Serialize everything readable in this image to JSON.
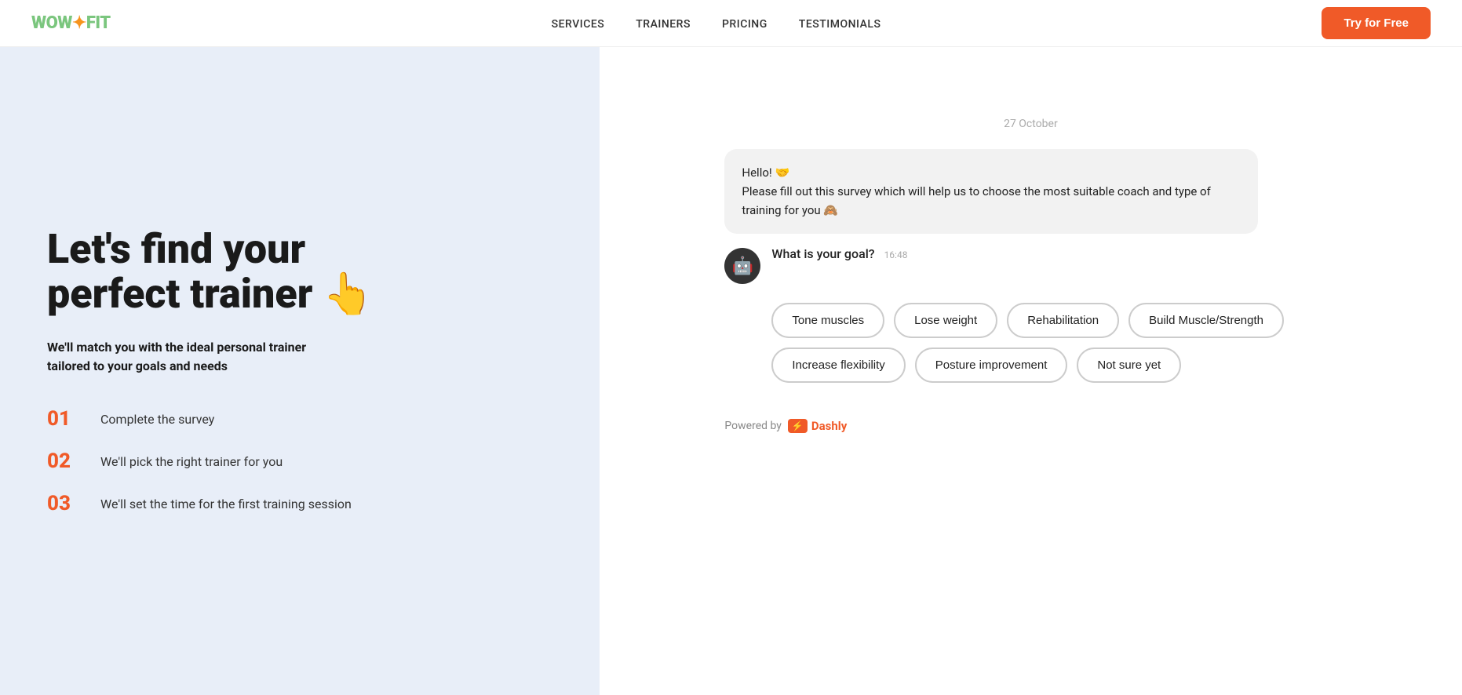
{
  "nav": {
    "logo": "WOW",
    "logo_fit": "FIT",
    "links": [
      {
        "label": "SERVICES",
        "href": "#"
      },
      {
        "label": "TRAINERS",
        "href": "#"
      },
      {
        "label": "PRICING",
        "href": "#"
      },
      {
        "label": "TESTIMONIALS",
        "href": "#"
      }
    ],
    "cta": "Try for Free"
  },
  "left": {
    "hero_title_line1": "Let's find your",
    "hero_title_line2": "perfect trainer 👆",
    "hero_subtitle": "We'll match you with the ideal personal trainer tailored to your goals and needs",
    "steps": [
      {
        "num": "01",
        "text": "Complete the survey"
      },
      {
        "num": "02",
        "text": "We'll pick the right trainer for you"
      },
      {
        "num": "03",
        "text": "We'll set the time for the first training session"
      }
    ]
  },
  "chat": {
    "date_label": "27 October",
    "welcome_message": "Hello! 🤝\nPlease fill out this survey which will help us to choose the most suitable coach and type of training for you 🙈",
    "bot_question": "What is your goal?",
    "time": "16:48",
    "options": [
      "Tone muscles",
      "Lose weight",
      "Rehabilitation",
      "Build Muscle/Strength",
      "Increase flexibility",
      "Posture improvement",
      "Not sure yet"
    ]
  },
  "footer": {
    "powered_by": "Powered by",
    "brand": "Dashly"
  }
}
